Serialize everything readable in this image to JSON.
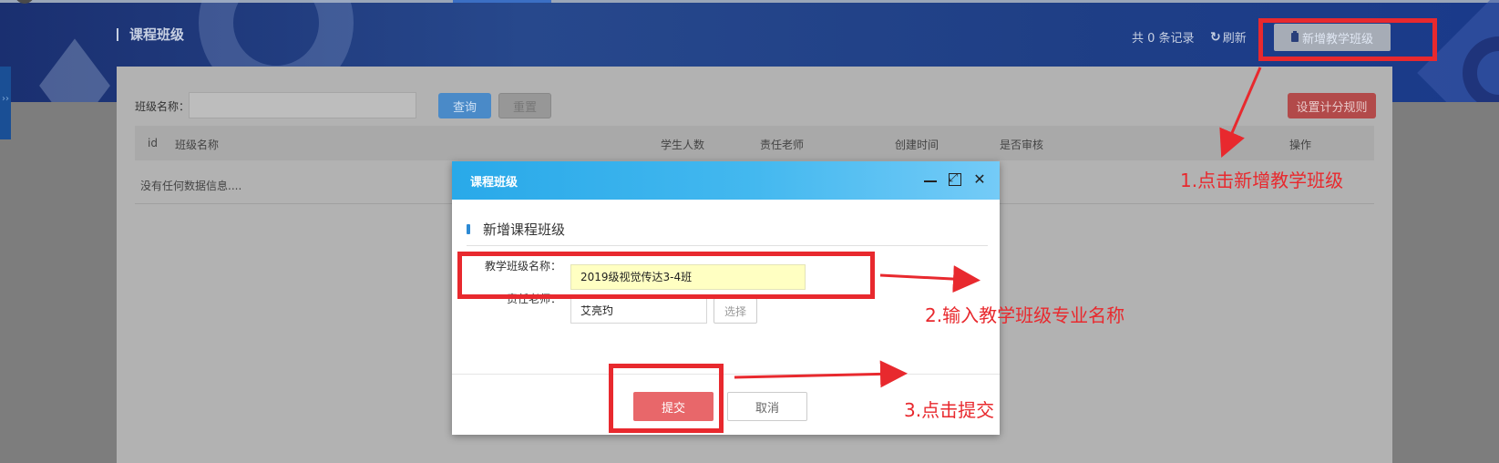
{
  "header": {
    "title": "课程班级",
    "record_count": "共 0 条记录",
    "refresh_label": "刷新",
    "add_button_label": "新增教学班级",
    "side_tab_glyph": "››"
  },
  "search": {
    "label": "班级名称：",
    "placeholder": "",
    "query_label": "查询",
    "reset_label": "重置",
    "rule_label": "设置计分规则"
  },
  "table": {
    "columns": [
      "id",
      "班级名称",
      "学生人数",
      "责任老师",
      "创建时间",
      "是否审核",
      "操作"
    ],
    "empty_text": "没有任何数据信息...."
  },
  "modal": {
    "title": "课程班级",
    "subtitle": "新增课程班级",
    "class_name_label": "教学班级名称：",
    "class_name_value": "2019级视觉传达3-4班",
    "teacher_label": "责任老师：",
    "teacher_value": "艾亮玓",
    "choose_label": "选择",
    "submit_label": "提交",
    "cancel_label": "取消"
  },
  "annotations": {
    "step1": "1.点击新增教学班级",
    "step2": "2.输入教学班级专业名称",
    "step3": "3.点击提交",
    "color": "#e8292e"
  },
  "colors": {
    "banner": "#27488c",
    "modal_header": "#29a9e9",
    "submit": "#e8676a",
    "input_highlight": "#ffffc2"
  }
}
